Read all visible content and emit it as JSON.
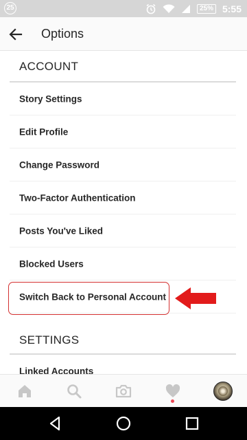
{
  "status_bar": {
    "notification_count": "25",
    "battery_percent": "25%",
    "time": "5:55",
    "icons": [
      "notification-count-icon",
      "alarm-icon",
      "wifi-icon",
      "signal-icon",
      "battery-icon"
    ]
  },
  "header": {
    "title": "Options",
    "back_icon": "back-arrow-icon"
  },
  "account_section": {
    "title": "ACCOUNT",
    "items": [
      {
        "label": "Story Settings"
      },
      {
        "label": "Edit Profile"
      },
      {
        "label": "Change Password"
      },
      {
        "label": "Two-Factor Authentication"
      },
      {
        "label": "Posts You've Liked"
      },
      {
        "label": "Blocked Users"
      },
      {
        "label": "Switch Back to Personal Account"
      }
    ]
  },
  "settings_section": {
    "title": "SETTINGS",
    "items": [
      {
        "label": "Linked Accounts"
      }
    ]
  },
  "annotation": {
    "highlight_color": "#d32f2f",
    "arrow_color": "#e21b1b",
    "arrow_icon": "red-arrow-left-icon"
  },
  "tab_bar": {
    "tabs": [
      "home-icon",
      "search-icon",
      "camera-icon",
      "heart-icon",
      "profile-avatar"
    ],
    "activity_dot_color": "#ed4956"
  },
  "nav_bar": {
    "buttons": [
      "back-triangle-icon",
      "home-circle-icon",
      "recents-square-icon"
    ]
  }
}
